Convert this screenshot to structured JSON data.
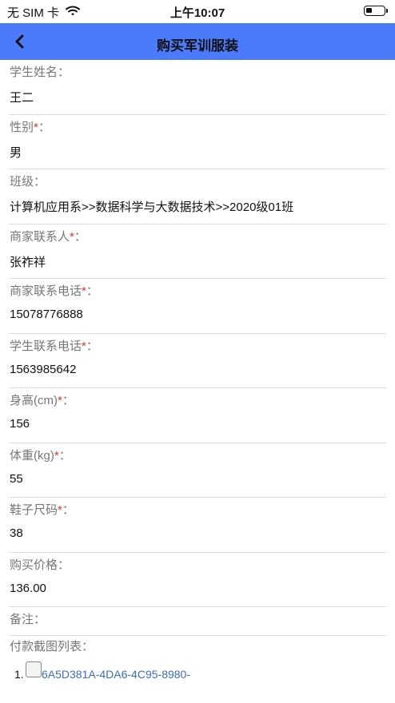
{
  "status_bar": {
    "carrier": "无 SIM 卡",
    "time": "上午10:07"
  },
  "navbar": {
    "title": "购买军训服装"
  },
  "fields": [
    {
      "label": "学生姓名：",
      "required": false,
      "value": "王二"
    },
    {
      "label": "性别",
      "required": true,
      "value": "男"
    },
    {
      "label": "班级：",
      "required": false,
      "value": "计算机应用系>>数据科学与大数据技术>>2020级01班"
    },
    {
      "label": "商家联系人",
      "required": true,
      "value": "张祚祥"
    },
    {
      "label": "商家联系电话",
      "required": true,
      "value": "15078776888"
    },
    {
      "label": "学生联系电话",
      "required": true,
      "value": "1563985642"
    },
    {
      "label": "身高(cm)",
      "required": true,
      "value": "156"
    },
    {
      "label": "体重(kg)",
      "required": true,
      "value": "55"
    },
    {
      "label": "鞋子尺码",
      "required": true,
      "value": "38"
    },
    {
      "label": "购买价格：",
      "required": false,
      "value": "136.00"
    },
    {
      "label": "备注：",
      "required": false,
      "value": ""
    }
  ],
  "required_mark": "*",
  "required_suffix": "：",
  "payment_list": {
    "title": "付款截图列表：",
    "items": [
      {
        "number": "1.",
        "link": "6A5D381A-4DA6-4C95-8980-"
      }
    ]
  },
  "colors": {
    "navbar": "#4b7bfb",
    "required": "#e03030",
    "link": "#3b6cc6"
  }
}
